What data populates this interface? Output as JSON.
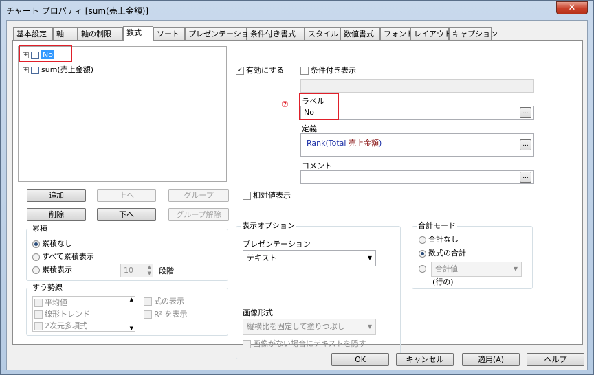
{
  "window": {
    "title": "チャート プロパティ [sum(売上金額)]",
    "close_glyph": "✕"
  },
  "tabs": [
    {
      "label": "基本設定",
      "active": false
    },
    {
      "label": "軸",
      "active": false
    },
    {
      "label": "軸の制限",
      "active": false
    },
    {
      "label": "数式",
      "active": true
    },
    {
      "label": "ソート",
      "active": false
    },
    {
      "label": "プレゼンテーション",
      "active": false
    },
    {
      "label": "条件付き書式",
      "active": false
    },
    {
      "label": "スタイル",
      "active": false
    },
    {
      "label": "数値書式",
      "active": false
    },
    {
      "label": "フォント",
      "active": false
    },
    {
      "label": "レイアウト",
      "active": false
    },
    {
      "label": "キャプション",
      "active": false
    }
  ],
  "tree": {
    "items": [
      {
        "label": "No",
        "selected": true,
        "expander": "⊞"
      },
      {
        "label": "sum(売上金額)",
        "selected": false,
        "expander": "⊞"
      }
    ]
  },
  "tree_buttons": {
    "add": "追加",
    "up": "上へ",
    "group": "グループ",
    "delete": "削除",
    "down": "下へ",
    "ungroup": "グループ解除"
  },
  "accumulation": {
    "label": "累積",
    "options": [
      "累積なし",
      "すべて累積表示",
      "累積表示"
    ],
    "selected_index": 0,
    "steps_value": "10",
    "steps_label": "段階"
  },
  "trendline": {
    "label": "すう勢線",
    "items": [
      "平均値",
      "線形トレンド",
      "2次元多項式"
    ],
    "show_equation": "式の表示",
    "show_r2": "R² を表示"
  },
  "enabled": {
    "label": "有効にする",
    "checked": true
  },
  "conditional": {
    "label": "条件付き表示",
    "checked": false,
    "value": ""
  },
  "annotation_number": "⑦",
  "label_field": {
    "label": "ラベル",
    "value": "No"
  },
  "definition": {
    "label": "定義",
    "func": "Rank(Total ",
    "field": "売上金額",
    "close": ")"
  },
  "comment": {
    "label": "コメント",
    "value": ""
  },
  "ellipsis": "...",
  "relative": {
    "label": "相対値表示",
    "checked": false
  },
  "display_options": {
    "label": "表示オプション",
    "presentation_label": "プレゼンテーション",
    "presentation_value": "テキスト",
    "image_format_label": "画像形式",
    "image_format_value": "縦横比を固定して塗りつぶし",
    "no_image_text": "画像がない場合にテキストを隠す"
  },
  "total_mode": {
    "label": "合計モード",
    "options": [
      "合計なし",
      "数式の合計"
    ],
    "selected_index": 1,
    "combo_value": "合計値",
    "rows_label": "(行の)"
  },
  "footer": {
    "ok": "OK",
    "cancel": "キャンセル",
    "apply": "適用(A)",
    "help": "ヘルプ"
  },
  "colors": {
    "highlight": "#3399ff",
    "annotation_red": "#e0202a",
    "formula_blue": "#1a2ea6",
    "formula_field": "#8b1a1a"
  }
}
